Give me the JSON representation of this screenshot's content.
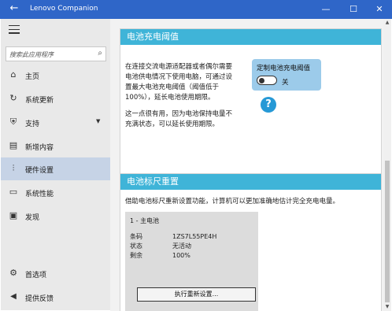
{
  "window": {
    "title": "Lenovo Companion",
    "back_icon": "←",
    "minimize_icon": "—",
    "maximize_icon": "☐",
    "close_icon": "✕"
  },
  "sidebar": {
    "search_placeholder": "搜索此应用程序",
    "items": [
      {
        "label": "主页",
        "icon": "home-icon",
        "glyph": "⌂"
      },
      {
        "label": "系统更新",
        "icon": "update-icon",
        "glyph": "↻"
      },
      {
        "label": "支持",
        "icon": "support-icon",
        "glyph": "⛨"
      },
      {
        "label": "新增内容",
        "icon": "news-icon",
        "glyph": "▤"
      },
      {
        "label": "硬件设置",
        "icon": "hardware-settings-icon",
        "glyph": "⫶"
      },
      {
        "label": "系统性能",
        "icon": "performance-icon",
        "glyph": "▭"
      },
      {
        "label": "发现",
        "icon": "discover-icon",
        "glyph": "▣"
      },
      {
        "label": "首选项",
        "icon": "gear-icon",
        "glyph": "⚙"
      },
      {
        "label": "提供反馈",
        "icon": "megaphone-icon",
        "glyph": "📢"
      }
    ],
    "active_item": "硬件设置"
  },
  "threshold_card": {
    "title": "电池充电阈值",
    "desc_lines": [
      "在连接交流电源适配器或者偶尔需要",
      "电池供电情况下使用电脑，可通过设",
      "置最大电池充电阈值（阈值低于",
      "100%），延长电池使用期限。"
    ],
    "desc2_lines": [
      "这一点很有用，因为电池保持电量不",
      "充满状态，可以延长使用期限。"
    ],
    "toggle_label": "定制电池充电阈值",
    "toggle_state": "关",
    "toggle_on": false,
    "help_glyph": "?"
  },
  "gauge_card": {
    "title": "电池标尺重置",
    "desc": "借助电池标尺重新设置功能，计算机可以更加准确地估计完全充电电量。",
    "battery_header": "1 - 主电池",
    "rows": [
      {
        "key": "条码",
        "value": "1ZS7L55PE4H"
      },
      {
        "key": "状态",
        "value": "无活动"
      },
      {
        "key": "剩余",
        "value": "100%"
      }
    ],
    "reset_button": "执行重新设置..."
  }
}
